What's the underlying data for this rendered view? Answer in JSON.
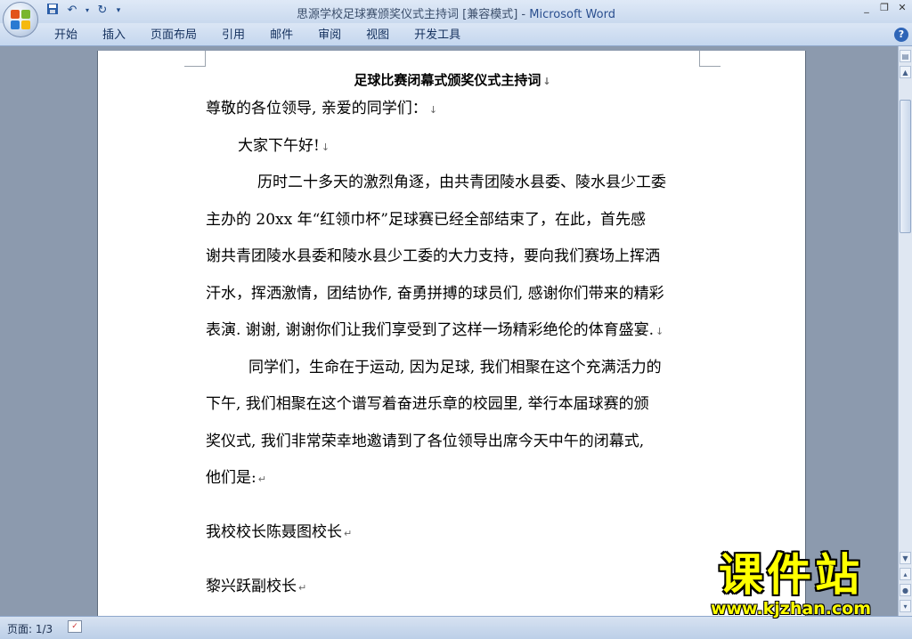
{
  "window": {
    "title": "思源学校足球赛颁奖仪式主持词 [兼容模式]",
    "title_separator": " - ",
    "app_name": "Microsoft Word"
  },
  "qat": {
    "save_icon": "save-icon",
    "undo_icon": "undo-icon",
    "redo_icon": "redo-icon"
  },
  "ribbon": {
    "tabs": [
      "开始",
      "插入",
      "页面布局",
      "引用",
      "邮件",
      "审阅",
      "视图",
      "开发工具"
    ],
    "help": "?"
  },
  "document": {
    "title": "足球比赛闭幕式颁奖仪式主持词",
    "lines": [
      "尊敬的各位领导, 亲爱的同学们：",
      "大家下午好!",
      "历时二十多天的激烈角逐，由共青团陵水县委、陵水县少工委",
      "主办的 20xx 年“红领巾杯”足球赛已经全部结束了，在此，首先感",
      "谢共青团陵水县委和陵水县少工委的大力支持，要向我们赛场上挥洒",
      "汗水，挥洒激情，团结协作, 奋勇拼搏的球员们, 感谢你们带来的精彩",
      "表演. 谢谢, 谢谢你们让我们享受到了这样一场精彩绝伦的体育盛宴.",
      "同学们，生命在于运动, 因为足球, 我们相聚在这个充满活力的",
      "下午, 我们相聚在这个谱写着奋进乐章的校园里, 举行本届球赛的颁",
      "奖仪式, 我们非常荣幸地邀请到了各位领导出席今天中午的闭幕式,",
      "他们是:",
      "我校校长陈聂图校长",
      "黎兴跃副校长"
    ],
    "marks": {
      "arrow": "↓",
      "return": "↵"
    }
  },
  "status": {
    "page": "页面: 1/3"
  },
  "watermark": {
    "brand": "课件站",
    "url": "www.kjzhan.com"
  }
}
